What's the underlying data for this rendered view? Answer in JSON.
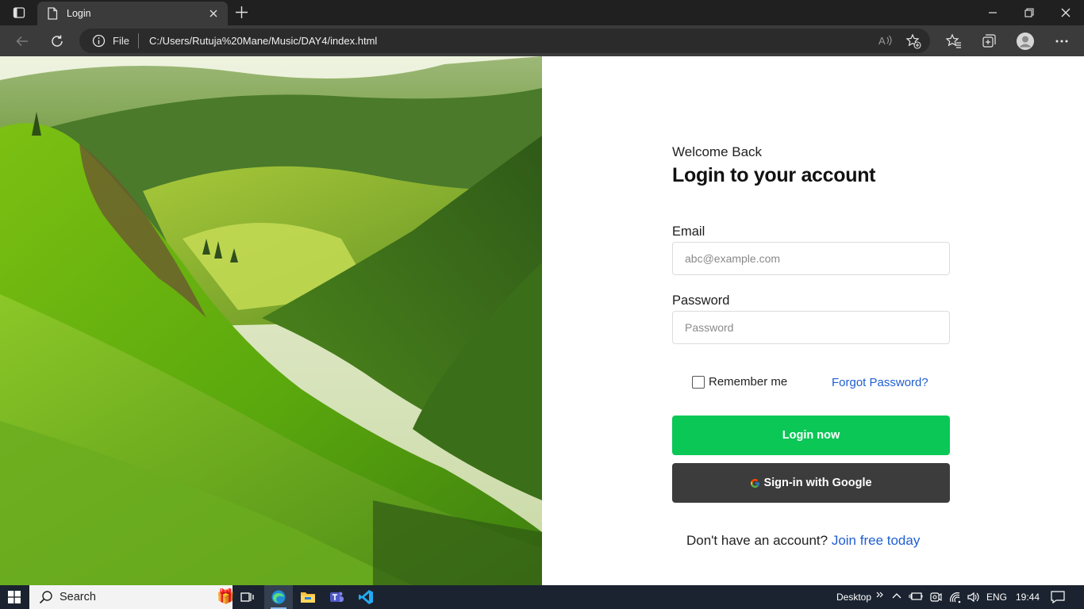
{
  "browser": {
    "tab_title": "Login",
    "address_scheme": "File",
    "url": "C:/Users/Rutuja%20Mane/Music/DAY4/index.html"
  },
  "login": {
    "welcome": "Welcome Back",
    "heading": "Login to your account",
    "email_label": "Email",
    "email_placeholder": "abc@example.com",
    "password_label": "Password",
    "password_placeholder": "Password",
    "remember_label": "Remember me",
    "forgot_label": "Forgot Password?",
    "login_button": "Login now",
    "google_button": "Sign-in with Google",
    "signup_prompt": "Don't have an account?",
    "signup_link": "Join free today"
  },
  "taskbar": {
    "search_label": "Search",
    "desktop_label": "Desktop",
    "language": "ENG",
    "time": "19:44"
  },
  "colors": {
    "login_button": "#0ac756",
    "google_button": "#3c3c3c",
    "link": "#1f5fd1"
  }
}
